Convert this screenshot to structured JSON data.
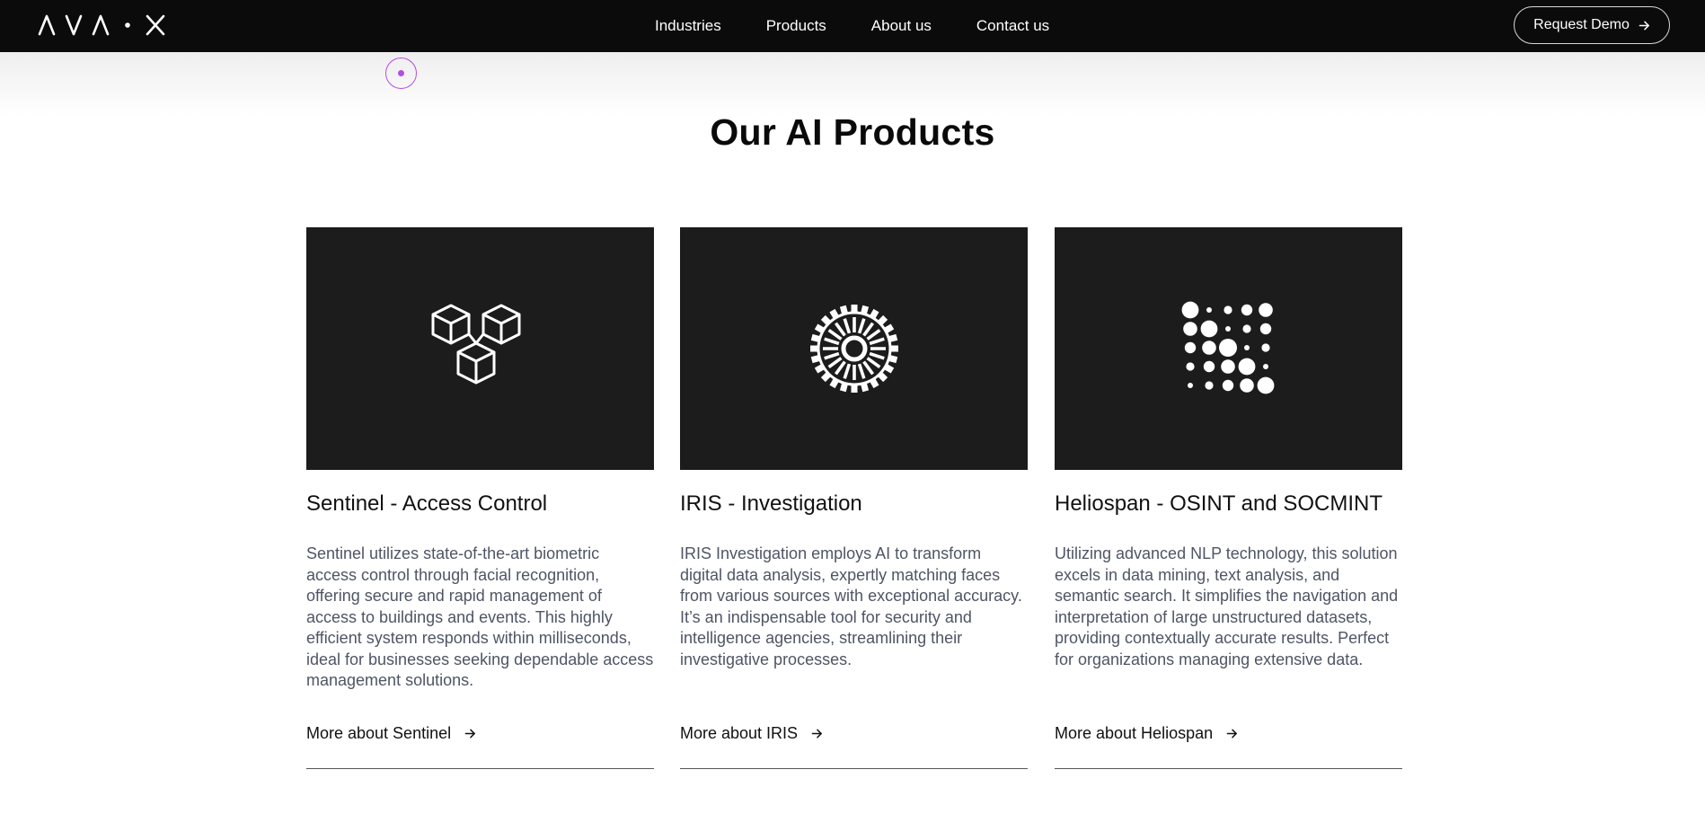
{
  "header": {
    "logo_text": "ΛVΛ·X",
    "nav": [
      "Industries",
      "Products",
      "About us",
      "Contact us"
    ],
    "cta_label": "Request Demo"
  },
  "section": {
    "title": "Our AI Products"
  },
  "products": [
    {
      "name": "Sentinel - Access Control",
      "description": "Sentinel utilizes state-of-the-art biometric access control through facial recognition, offering secure and rapid management of access to buildings and events. This highly efficient system responds within milliseconds, ideal for businesses seeking dependable access management solutions.",
      "link": "More about Sentinel",
      "icon": "cubes-icon"
    },
    {
      "name": "IRIS - Investigation",
      "description": "IRIS Investigation employs AI to transform digital data analysis, expertly matching faces from various sources with exceptional accuracy. It’s an indispensable tool for security and intelligence agencies, streamlining their investigative processes.",
      "link": "More about IRIS",
      "icon": "iris-gear-icon"
    },
    {
      "name": "Heliospan - OSINT and SOCMINT",
      "description": "Utilizing advanced NLP technology, this solution excels in data mining, text analysis, and semantic search. It simplifies the navigation and interpretation of large unstructured datasets, providing contextually accurate results. Perfect for organizations managing extensive data.",
      "link": "More about Heliospan",
      "icon": "dot-grid-icon"
    }
  ],
  "colors": {
    "header_bg": "#0b0b0b",
    "card_bg": "#1c1c1c",
    "body_text": "#4e5564",
    "cursor_accent": "#b44ee0"
  }
}
